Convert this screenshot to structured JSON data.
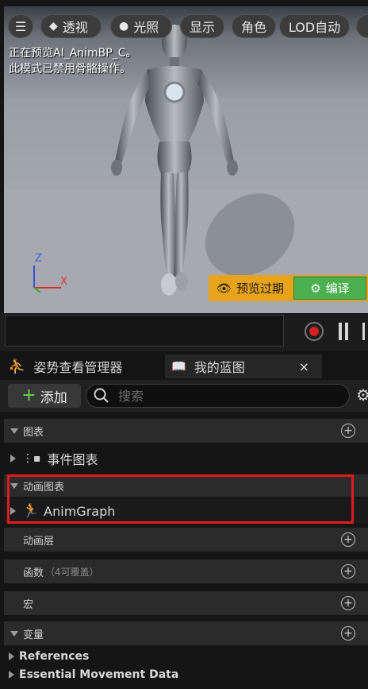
{
  "viewport": {
    "toolbar": {
      "menu_icon": "hamburger-icon",
      "perspective_label": "透视",
      "lighting_label": "光照",
      "show_label": "显示",
      "character_label": "角色",
      "lod_label": "LOD自动"
    },
    "info_line1": "正在预览AI_AnimBP_C。",
    "info_line2": "此模式已禁用骨骼操作。",
    "axis_z": "Z",
    "axis_x": "X",
    "preview_expired_label": "预览过期",
    "compile_label": "编译"
  },
  "tabs": {
    "pose_watch_label": "姿势查看管理器",
    "my_blueprint_label": "我的蓝图",
    "close_glyph": "×"
  },
  "toolbar": {
    "add_label": "添加",
    "search_placeholder": "搜索"
  },
  "panel": {
    "graphs_label": "图表",
    "event_graph_label": "事件图表",
    "anim_graphs_label": "动画图表",
    "anim_graph_item": "AnimGraph",
    "anim_layers_label": "动画层",
    "functions_label": "函数",
    "functions_count": "（4可覆盖）",
    "macros_label": "宏",
    "variables_label": "变量",
    "references_label": "References",
    "essential_movement_label": "Essential Movement Data"
  },
  "colors": {
    "highlight": "#e01b1b",
    "compile_green": "#4caf50",
    "warning_amber": "#e8a31a"
  }
}
